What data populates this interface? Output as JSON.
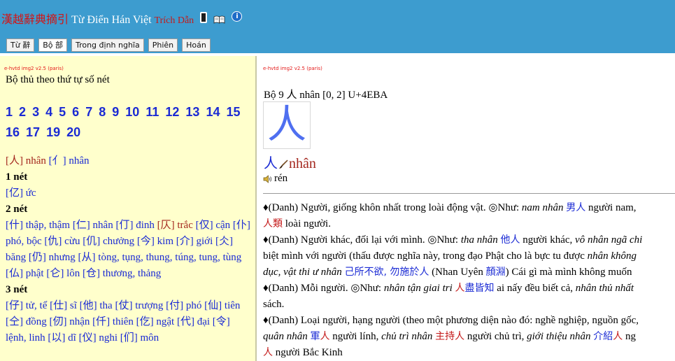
{
  "header": {
    "logo_han": "漢越辭典摘引",
    "logo_viet": "Từ Điển Hán Việt",
    "logo_trich": "Trích Dẫn",
    "tabs": [
      "Từ 辭",
      "Bộ 部",
      "Trong định nghĩa",
      "Phiên",
      "Hoán"
    ],
    "active_tab": "Bộ 部",
    "icons": [
      "phone-icon",
      "book-icon",
      "info-icon"
    ]
  },
  "left": {
    "version": "e-hvtd img2 v2.5 (paris)",
    "title": "Bộ thủ theo thứ tự số nét",
    "stroke_counts": [
      "1",
      "2",
      "3",
      "4",
      "5",
      "6",
      "7",
      "8",
      "9",
      "10",
      "11",
      "12",
      "13",
      "14",
      "15",
      "16",
      "17",
      "19",
      "20"
    ],
    "header_radicals": [
      {
        "text": "[人] nhân",
        "tone": "red"
      },
      {
        "text": "[亻] nhân",
        "tone": "blue"
      }
    ],
    "groups": [
      {
        "label": "1 nét",
        "items": [
          "[亿] ức"
        ]
      },
      {
        "label": "2 nét",
        "items": [
          "[什] thập, thậm",
          "[仁] nhân",
          "[仃] đinh",
          "[仄] trắc",
          "[仅] cận",
          "[仆] phó, bộc",
          "[仇] cừu",
          "[仉] chưởng",
          "[今] kim",
          "[介] giới",
          "[仌] băng",
          "[仍] nhưng",
          "[从] tòng, tụng, thung, túng, tung, tùng",
          "[仏] phật",
          "[仑] lôn",
          "[仓] thương, thảng"
        ],
        "red_item": "[仄] trắc"
      },
      {
        "label": "3 nét",
        "items": [
          "[仔] tử, tể",
          "[仕] sĩ",
          "[他] tha",
          "[仗] trượng",
          "[付] phó",
          "[仙] tiên",
          "[仝] đồng",
          "[仞] nhận",
          "[仟] thiên",
          "[仡] ngật",
          "[代] đại",
          "[令] lệnh, linh",
          "[以] dĩ",
          "[仪] nghi",
          "[们] môn"
        ]
      }
    ]
  },
  "right": {
    "version": "e-hvtd img2 v2.5 (paris)",
    "entry_head": "Bộ 9 人 nhân [0, 2] U+4EBA",
    "glyph": "人",
    "headword_han": "人",
    "headword_reading": "nhân",
    "pinyin": "rén",
    "icons": [
      "brush-icon",
      "speaker-icon"
    ],
    "definitions": {
      "d1_a": "♦(Danh) Người, giống khôn nhất trong loài động vật. ◎Như: ",
      "d1_b": "nam nhân",
      "d1_c": "男人",
      "d1_d": " người nam,",
      "d1_e": "人類",
      "d1_f": " loài người.",
      "d2_a": "♦(Danh) Người khác, đối lại với mình. ◎Như: ",
      "d2_b": "tha nhân",
      "d2_c": "他人",
      "d2_d": " người khác, ",
      "d2_e": "vô nhân ngã chi",
      "d2_f": "biệt mình với người (thấu được nghĩa này, trong đạo Phật cho là bực tu được ",
      "d2_g": "nhân không",
      "d2_h": "dục, vật thi ư nhân",
      "d2_i": "己所不欲, 勿施於人",
      "d2_j": " (Nhan Uyên ",
      "d2_k": "顏淵",
      "d2_l": ") Cái gì mà mình không muốn",
      "d3_a": "♦(Danh) Mỗi người. ◎Như: ",
      "d3_b": "nhân tận giai tri",
      "d3_c": "人",
      "d3_d": "盡皆知",
      "d3_e": " ai nấy đều biết cả, ",
      "d3_f": "nhân thủ nhất",
      "d3_g": "sách.",
      "d4_a": "♦(Danh) Loại người, hạng người (theo một phương diện nào đó: nghề nghiệp, nguồn gốc,",
      "d4_b": "quân nhân",
      "d4_c": "軍",
      "d4_d": "人",
      "d4_e": " người lính, ",
      "d4_f": "chủ trì nhân",
      "d4_g": "主持人",
      "d4_h": " người chủ trì, ",
      "d4_i": "giới thiệu nhân",
      "d4_j": "介紹",
      "d4_k": "人",
      "d4_l": " ng",
      "d5_a": "人",
      "d5_b": " người Bắc Kinh"
    }
  },
  "colors": {
    "header_bg": "#3d9ccf",
    "left_bg": "#ffffcc",
    "link_blue": "#1a2ad4",
    "accent_red": "#a3261d"
  }
}
